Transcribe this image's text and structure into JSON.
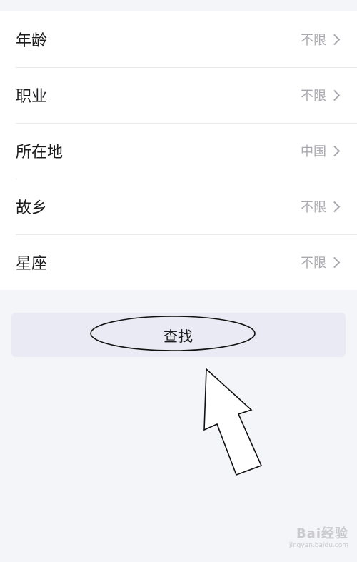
{
  "filters": [
    {
      "label": "年龄",
      "value": "不限"
    },
    {
      "label": "职业",
      "value": "不限"
    },
    {
      "label": "所在地",
      "value": "中国"
    },
    {
      "label": "故乡",
      "value": "不限"
    },
    {
      "label": "星座",
      "value": "不限"
    }
  ],
  "search_button": {
    "label": "查找"
  },
  "watermark": {
    "logo": "Bai经验",
    "url": "jingyan.baidu.com"
  },
  "colors": {
    "background": "#f4f5f9",
    "list_bg": "#ffffff",
    "button_bg": "#e9eaf3",
    "muted_text": "#a9a9b0"
  }
}
